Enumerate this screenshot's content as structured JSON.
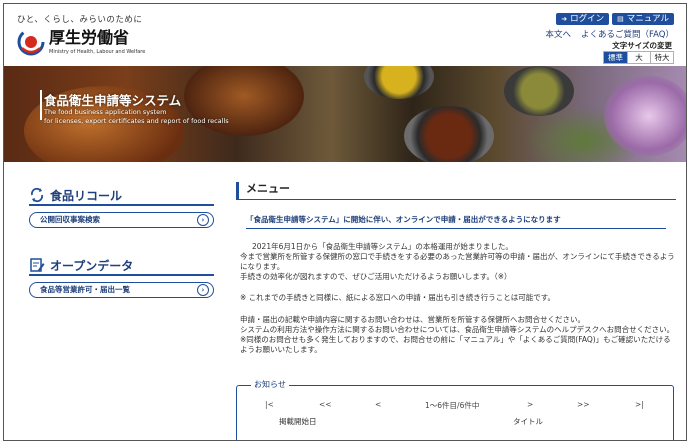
{
  "header": {
    "tagline": "ひと、くらし、みらいのために",
    "logo_jp": "厚生労働省",
    "logo_en": "Ministry of Health, Labour and Welfare",
    "login_label": "ログイン",
    "manual_label": "マニュアル",
    "links": [
      "本文へ",
      "よくあるご質問（FAQ）"
    ],
    "text_size_label": "文字サイズの変更",
    "size_options": [
      "標準",
      "大",
      "特大"
    ]
  },
  "banner": {
    "title": "食品衛生申請等システム",
    "subtitle_1": "The food business application system",
    "subtitle_2": "for licenses, export certificates and report of food recalls"
  },
  "sidebar": {
    "sections": [
      {
        "title": "食品リコール",
        "link": "公開回収事案検索"
      },
      {
        "title": "オープンデータ",
        "link": "食品等営業許可・届出一覧"
      }
    ]
  },
  "main": {
    "heading": "メニュー",
    "notice_title": "「食品衛生申請等システム」に開始に伴い、オンラインで申請・届出ができるようになります",
    "p1": [
      "2021年6月1日から「食品衛生申請等システム」の本格運用が始まりました。",
      "今まで営業所を所管する保健所の窓口で手続きをする必要のあった営業許可等の申請・届出が、オンラインにて手続きできるよう",
      "になります。",
      "手続きの効率化が図れますので、ぜひご活用いただけるようお願いします。（※）"
    ],
    "p2": [
      "※ これまでの手続きと同様に、紙による窓口への申請・届出も引き続き行うことは可能です。"
    ],
    "p3": [
      "申請・届出の記載や申請内容に関するお問い合わせは、営業所を所管する保健所へお問合せください。",
      "システムの利用方法や操作方法に関するお問い合わせについては、食品衛生申請等システムのヘルプデスクへお問合せください。",
      "※同様のお問合せも多く発生しておりますので、お問合せの前に「マニュアル」や「よくあるご質問(FAQ)」もご確認いただける",
      "ようお願いいたします。"
    ]
  },
  "oshirase": {
    "label": "お知らせ",
    "pager": [
      "|<",
      "<<",
      "<",
      "1〜6件目/6件中",
      ">",
      ">>",
      ">|"
    ],
    "col_date": "掲載開始日",
    "col_title": "タイトル"
  },
  "colors": {
    "accent": "#1f4f9c",
    "link_text": "#1f3f7a"
  }
}
